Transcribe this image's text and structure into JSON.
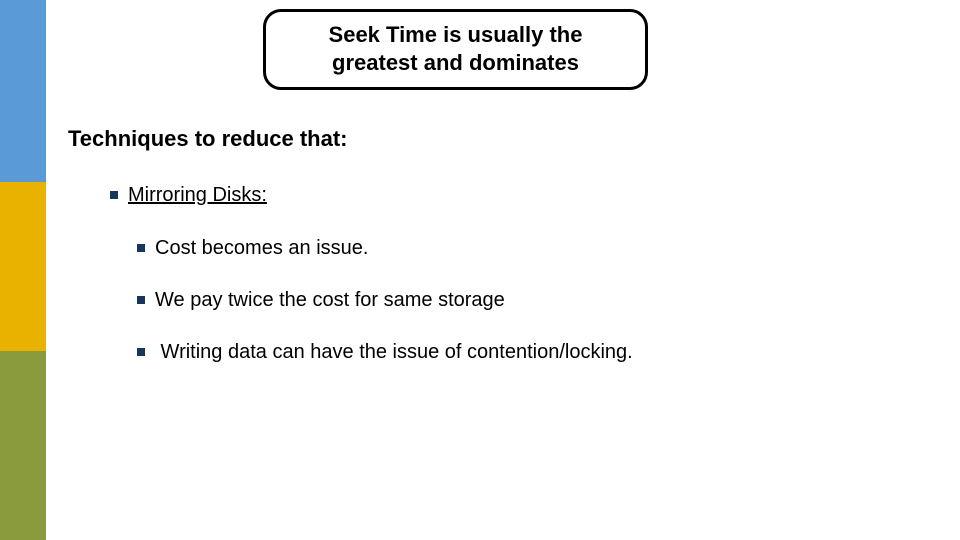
{
  "callout": {
    "line1": "Seek Time is usually the",
    "line2": "greatest and dominates"
  },
  "section_title": "Techniques to reduce that:",
  "bullets": {
    "level1": "Mirroring Disks:",
    "sub1": "Cost becomes an issue.",
    "sub2": "We pay twice the cost for same storage",
    "sub3": " Writing data can have the issue of contention/locking."
  },
  "colors": {
    "bullet": "#17365d",
    "strip_blue": "#5b9bd5",
    "strip_gold": "#eab200",
    "strip_olive": "#8a9b3d"
  }
}
